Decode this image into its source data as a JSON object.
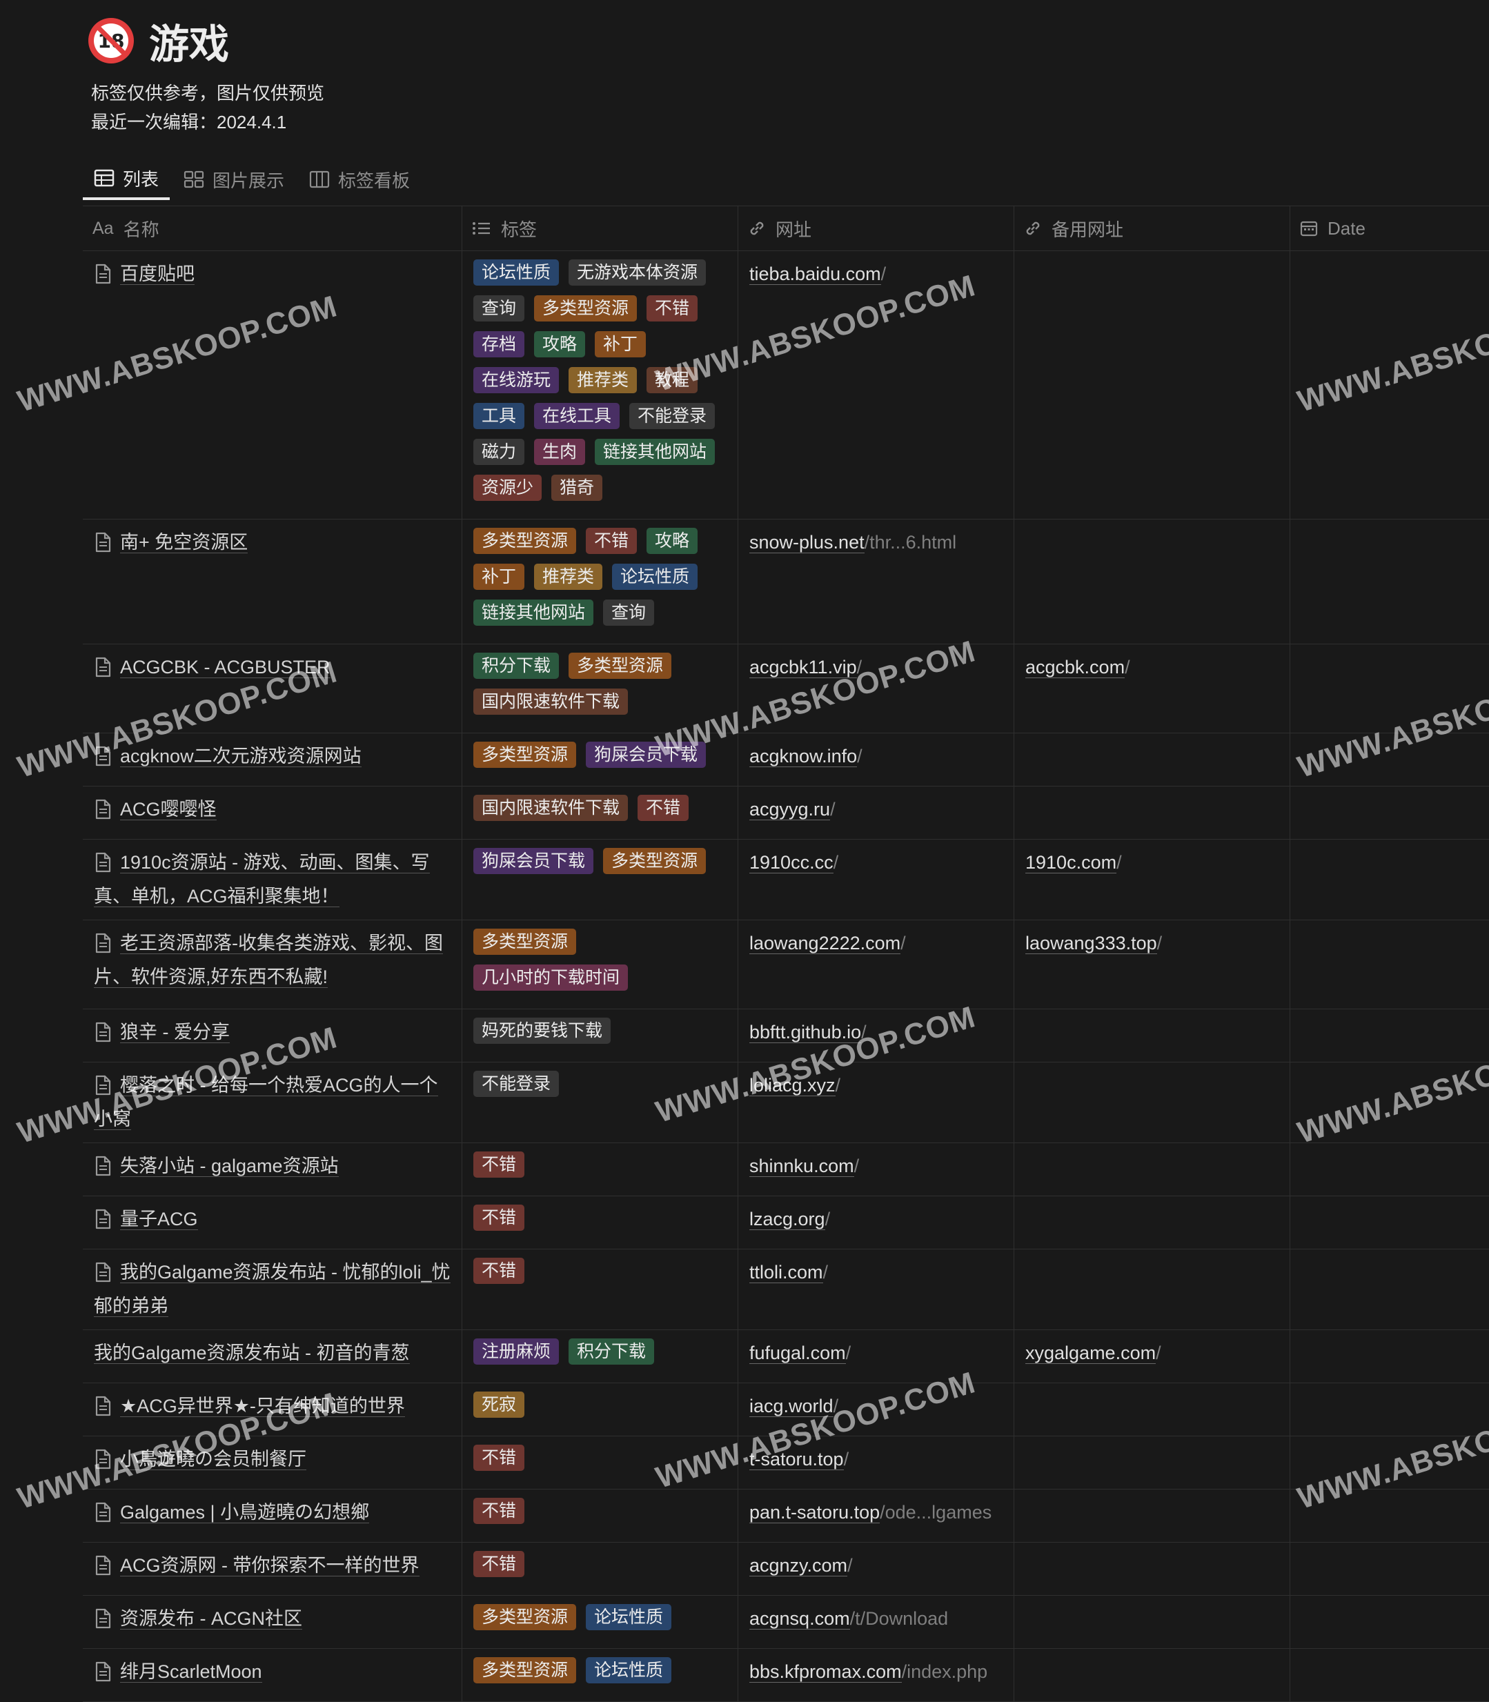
{
  "page": {
    "title": "游戏",
    "age_badge": "18",
    "description_1": "标签仅供参考，图片仅供预览",
    "description_2": "最近一次编辑：2024.4.1"
  },
  "tabs": [
    {
      "label": "列表",
      "active": true
    },
    {
      "label": "图片展示",
      "active": false
    },
    {
      "label": "标签看板",
      "active": false
    }
  ],
  "columns": {
    "name": {
      "icon_text": "Aa",
      "label": "名称"
    },
    "tags": {
      "label": "标签"
    },
    "url": {
      "label": "网址"
    },
    "alt_url": {
      "label": "备用网址"
    },
    "date": {
      "label": "Date"
    }
  },
  "tag_colors": {
    "blue": "#28456c",
    "gray": "#373737",
    "orange": "#854c1d",
    "red": "#6e3630",
    "purple": "#492f64",
    "green": "#2b593f",
    "brown": "#603b2c",
    "pink": "#69314c",
    "yellow": "#89632a"
  },
  "rows": [
    {
      "name": "百度贴吧",
      "icon": true,
      "tags": [
        [
          "论坛性质",
          "blue"
        ],
        [
          "无游戏本体资源",
          "gray"
        ],
        [
          "查询",
          "gray"
        ],
        [
          "多类型资源",
          "orange"
        ],
        [
          "不错",
          "red"
        ],
        [
          "存档",
          "purple"
        ],
        [
          "攻略",
          "green"
        ],
        [
          "补丁",
          "orange"
        ],
        [
          "在线游玩",
          "purple"
        ],
        [
          "推荐类",
          "yellow"
        ],
        [
          "教程",
          "brown"
        ],
        [
          "工具",
          "blue"
        ],
        [
          "在线工具",
          "purple"
        ],
        [
          "不能登录",
          "gray"
        ],
        [
          "磁力",
          "gray"
        ],
        [
          "生肉",
          "pink"
        ],
        [
          "链接其他网站",
          "green"
        ],
        [
          "资源少",
          "red"
        ],
        [
          "猎奇",
          "brown"
        ]
      ],
      "url": "tieba.baidu.com",
      "url_dim": "/",
      "alt": "",
      "alt_dim": ""
    },
    {
      "name": "南+ 免空资源区",
      "icon": true,
      "tags": [
        [
          "多类型资源",
          "orange"
        ],
        [
          "不错",
          "red"
        ],
        [
          "攻略",
          "green"
        ],
        [
          "补丁",
          "orange"
        ],
        [
          "推荐类",
          "yellow"
        ],
        [
          "论坛性质",
          "blue"
        ],
        [
          "链接其他网站",
          "green"
        ],
        [
          "查询",
          "gray"
        ]
      ],
      "url": "snow-plus.net",
      "url_dim": "/thr...6.html",
      "alt": "",
      "alt_dim": ""
    },
    {
      "name": "ACGCBK - ACGBUSTER",
      "icon": true,
      "tags": [
        [
          "积分下载",
          "green"
        ],
        [
          "多类型资源",
          "orange"
        ],
        [
          "国内限速软件下载",
          "brown"
        ]
      ],
      "url": "acgcbk11.vip",
      "url_dim": "/",
      "alt": "acgcbk.com",
      "alt_dim": "/"
    },
    {
      "name": "acgknow二次元游戏资源网站",
      "icon": true,
      "tags": [
        [
          "多类型资源",
          "orange"
        ],
        [
          "狗屎会员下载",
          "purple"
        ]
      ],
      "url": "acgknow.info",
      "url_dim": "/",
      "alt": "",
      "alt_dim": ""
    },
    {
      "name": "ACG嘤嘤怪",
      "icon": true,
      "tags": [
        [
          "国内限速软件下载",
          "brown"
        ],
        [
          "不错",
          "red"
        ]
      ],
      "url": "acgyyg.ru",
      "url_dim": "/",
      "alt": "",
      "alt_dim": ""
    },
    {
      "name": "1910c资源站 - 游戏、动画、图集、写真、单机，ACG福利聚集地！",
      "icon": true,
      "tags": [
        [
          "狗屎会员下载",
          "purple"
        ],
        [
          "多类型资源",
          "orange"
        ]
      ],
      "url": "1910cc.cc",
      "url_dim": "/",
      "alt": "1910c.com",
      "alt_dim": "/"
    },
    {
      "name": "老王资源部落-收集各类游戏、影视、图片、软件资源,好东西不私藏!",
      "icon": true,
      "tags": [
        [
          "多类型资源",
          "orange"
        ],
        [
          "几小时的下载时间",
          "pink"
        ]
      ],
      "url": "laowang2222.com",
      "url_dim": "/",
      "alt": "laowang333.top",
      "alt_dim": "/"
    },
    {
      "name": "狼辛 - 爱分享",
      "icon": true,
      "tags": [
        [
          "妈死的要钱下载",
          "gray"
        ]
      ],
      "url": "bbftt.github.io",
      "url_dim": "/",
      "alt": "",
      "alt_dim": ""
    },
    {
      "name": "樱落之时 - 给每一个热爱ACG的人一个小窝",
      "icon": true,
      "tags": [
        [
          "不能登录",
          "gray"
        ]
      ],
      "url": "loliacg.xyz",
      "url_dim": "/",
      "alt": "",
      "alt_dim": ""
    },
    {
      "name": "失落小站 - galgame资源站",
      "icon": true,
      "tags": [
        [
          "不错",
          "red"
        ]
      ],
      "url": "shinnku.com",
      "url_dim": "/",
      "alt": "",
      "alt_dim": ""
    },
    {
      "name": "量子ACG",
      "icon": true,
      "tags": [
        [
          "不错",
          "red"
        ]
      ],
      "url": "lzacg.org",
      "url_dim": "/",
      "alt": "",
      "alt_dim": ""
    },
    {
      "name": "我的Galgame资源发布站 - 忧郁的loli_忧郁的弟弟",
      "icon": true,
      "tags": [
        [
          "不错",
          "red"
        ]
      ],
      "url": "ttloli.com",
      "url_dim": "/",
      "alt": "",
      "alt_dim": ""
    },
    {
      "name": "我的Galgame资源发布站 - 初音的青葱",
      "icon": false,
      "tags": [
        [
          "注册麻烦",
          "purple"
        ],
        [
          "积分下载",
          "green"
        ]
      ],
      "url": "fufugal.com",
      "url_dim": "/",
      "alt": "xygalgame.com",
      "alt_dim": "/"
    },
    {
      "name": "★ACG异世界★-只有绅知道的世界",
      "icon": true,
      "tags": [
        [
          "死寂",
          "yellow"
        ]
      ],
      "url": "iacg.world",
      "url_dim": "/",
      "alt": "",
      "alt_dim": ""
    },
    {
      "name": "小鳥遊曉の会员制餐厅",
      "icon": true,
      "tags": [
        [
          "不错",
          "red"
        ]
      ],
      "url": "t-satoru.top",
      "url_dim": "/",
      "alt": "",
      "alt_dim": ""
    },
    {
      "name": "Galgames | 小鳥遊曉の幻想鄉",
      "icon": true,
      "tags": [
        [
          "不错",
          "red"
        ]
      ],
      "url": "pan.t-satoru.top",
      "url_dim": "/ode...lgames",
      "alt": "",
      "alt_dim": ""
    },
    {
      "name": "ACG资源网 - 带你探索不一样的世界",
      "icon": true,
      "tags": [
        [
          "不错",
          "red"
        ]
      ],
      "url": "acgnzy.com",
      "url_dim": "/",
      "alt": "",
      "alt_dim": ""
    },
    {
      "name": "资源发布 - ACGN社区",
      "icon": true,
      "tags": [
        [
          "多类型资源",
          "orange"
        ],
        [
          "论坛性质",
          "blue"
        ]
      ],
      "url": "acgnsq.com",
      "url_dim": "/t/Download",
      "alt": "",
      "alt_dim": ""
    },
    {
      "name": "绯月ScarletMoon",
      "icon": true,
      "tags": [
        [
          "多类型资源",
          "orange"
        ],
        [
          "论坛性质",
          "blue"
        ]
      ],
      "url": "bbs.kfpromax.com",
      "url_dim": "/index.php",
      "alt": "",
      "alt_dim": ""
    }
  ],
  "watermark": "WWW.ABSKOOP.COM"
}
